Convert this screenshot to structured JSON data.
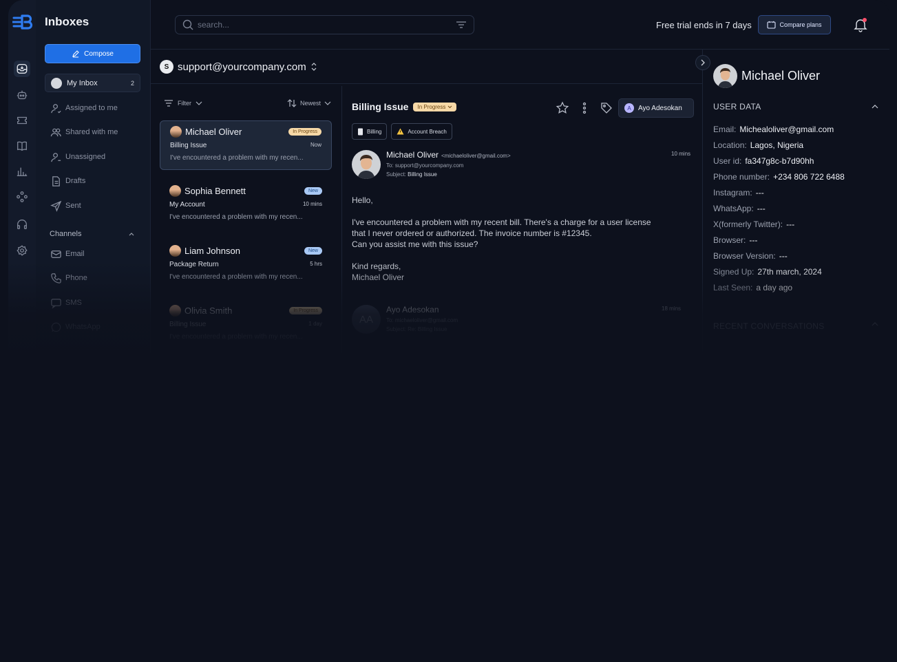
{
  "sidebar": {
    "title": "Inboxes",
    "compose_label": "Compose",
    "my_inbox": {
      "label": "My Inbox",
      "count": "2"
    },
    "nav": [
      {
        "label": "Assigned to me"
      },
      {
        "label": "Shared with me"
      },
      {
        "label": "Unassigned"
      },
      {
        "label": "Drafts"
      },
      {
        "label": "Sent"
      }
    ],
    "channels_heading": "Channels",
    "channels": [
      {
        "label": "Email"
      },
      {
        "label": "Phone"
      },
      {
        "label": "SMS"
      },
      {
        "label": "WhatsApp"
      }
    ]
  },
  "topbar": {
    "search_placeholder": "search...",
    "trial_text": "Free trial ends in 7 days",
    "compare_label": "Compare plans"
  },
  "account": {
    "initial": "S",
    "email": "support@yourcompany.com"
  },
  "list": {
    "filter_label": "Filter",
    "sort_label": "Newest",
    "conversations": [
      {
        "name": "Michael Oliver",
        "status": "In Progress",
        "subject": "Billing Issue",
        "time": "Now",
        "preview": "I've encountered a problem with my recen..."
      },
      {
        "name": "Sophia Bennett",
        "status": "New",
        "subject": "My Account",
        "time": "10 mins",
        "preview": "I've encountered a problem with my recen..."
      },
      {
        "name": "Liam Johnson",
        "status": "New",
        "subject": "Package Return",
        "time": "5 hrs",
        "preview": "I've encountered a problem with my recen..."
      },
      {
        "name": "Olivia Smith",
        "status": "In Progress",
        "subject": "Billing Issue",
        "time": "1 day",
        "preview": "I've encountered a problem with my recen..."
      }
    ]
  },
  "thread": {
    "subject": "Billing Issue",
    "status": "In Progress",
    "assignee": {
      "initial": "A",
      "name": "Ayo Adesokan"
    },
    "tags": [
      "Billing",
      "Account Breach"
    ],
    "message": {
      "from_name": "Michael Oliver",
      "from_email": "<michaeloliver@gmail.com>",
      "to": "To: support@yourcompany.com",
      "subject_label": "Subject:",
      "subject": "Billing Issue",
      "time": "10 mins",
      "greeting": "Hello,",
      "body_line1": "I've encountered a problem with my recent bill. There's a charge for a user license",
      "body_line2": "that I never ordered or authorized. The invoice number is #12345.",
      "body_line3": "Can you assist me with this issue?",
      "sign1": "Kind regards,",
      "sign2": "Michael Oliver"
    },
    "reply": {
      "initials": "AA",
      "from_name": "Ayo Adesokan",
      "to": "To: michaeloliver@gmail.com",
      "subject": "Subject: Re: Billing Issue",
      "time": "18 mins"
    }
  },
  "user": {
    "name": "Michael Oliver",
    "section_title": "USER DATA",
    "fields": [
      {
        "label": "Email:",
        "value": "Michealoliver@gmail.com"
      },
      {
        "label": "Location:",
        "value": "Lagos, Nigeria"
      },
      {
        "label": "User id:",
        "value": "fa347g8c-b7d90hh"
      },
      {
        "label": "Phone number:",
        "value": "+234 806 722 6488"
      },
      {
        "label": "Instagram:",
        "value": "---"
      },
      {
        "label": "WhatsApp:",
        "value": "---"
      },
      {
        "label": "X(formerly Twitter):",
        "value": "---"
      },
      {
        "label": "Browser:",
        "value": "---"
      },
      {
        "label": "Browser Version:",
        "value": "---"
      },
      {
        "label": "Signed Up:",
        "value": "27th march, 2024"
      },
      {
        "label": "Last Seen:",
        "value": "a day ago"
      }
    ],
    "recent_title": "RECENT CONVERSATIONS"
  },
  "colors": {
    "accent": "#1f6fe5",
    "in_progress": "#f6d8a6",
    "new": "#a9c9f5",
    "background": "#0d111d"
  }
}
